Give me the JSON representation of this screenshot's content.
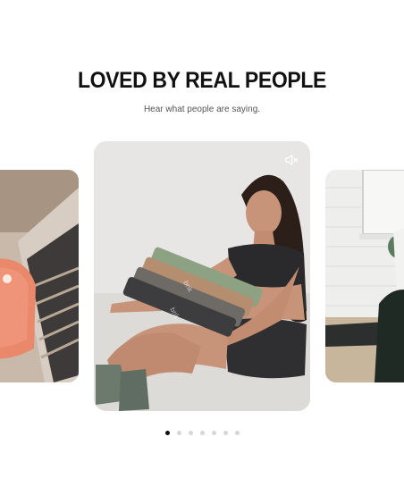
{
  "section": {
    "title": "LOVED BY REAL PEOPLE",
    "subtitle": "Hear what people are saying."
  },
  "carousel": {
    "slides": [
      {
        "name": "slide-previous",
        "icon": "video-thumbnail"
      },
      {
        "name": "slide-current",
        "icon": "video-thumbnail",
        "mute_icon": "speaker-muted-icon"
      },
      {
        "name": "slide-next",
        "icon": "video-thumbnail"
      }
    ],
    "dot_count": 7,
    "active_index": 0
  },
  "colors": {
    "heading": "#111111",
    "subtitle": "#555555",
    "dot_active": "#111111",
    "dot_inactive": "#d6d6d6"
  }
}
